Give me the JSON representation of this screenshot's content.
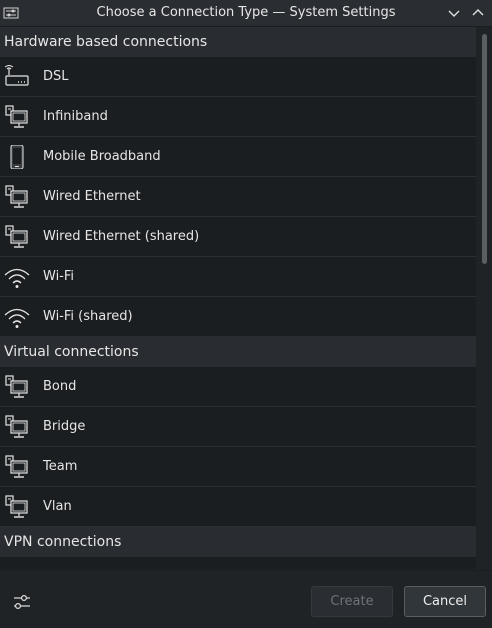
{
  "window": {
    "title": "Choose a Connection Type — System Settings"
  },
  "sections": [
    {
      "label": "Hardware based connections",
      "items": [
        {
          "label": "DSL",
          "icon": "dsl-modem-icon"
        },
        {
          "label": "Infiniband",
          "icon": "network-wired-icon"
        },
        {
          "label": "Mobile Broadband",
          "icon": "mobile-phone-icon"
        },
        {
          "label": "Wired Ethernet",
          "icon": "network-wired-icon"
        },
        {
          "label": "Wired Ethernet (shared)",
          "icon": "network-wired-icon"
        },
        {
          "label": "Wi-Fi",
          "icon": "wifi-icon"
        },
        {
          "label": "Wi-Fi (shared)",
          "icon": "wifi-icon"
        }
      ]
    },
    {
      "label": "Virtual connections",
      "items": [
        {
          "label": "Bond",
          "icon": "network-wired-icon"
        },
        {
          "label": "Bridge",
          "icon": "network-wired-icon"
        },
        {
          "label": "Team",
          "icon": "network-wired-icon"
        },
        {
          "label": "Vlan",
          "icon": "network-wired-icon"
        }
      ]
    },
    {
      "label": "VPN connections",
      "items": []
    }
  ],
  "footer": {
    "create_label": "Create",
    "cancel_label": "Cancel"
  }
}
